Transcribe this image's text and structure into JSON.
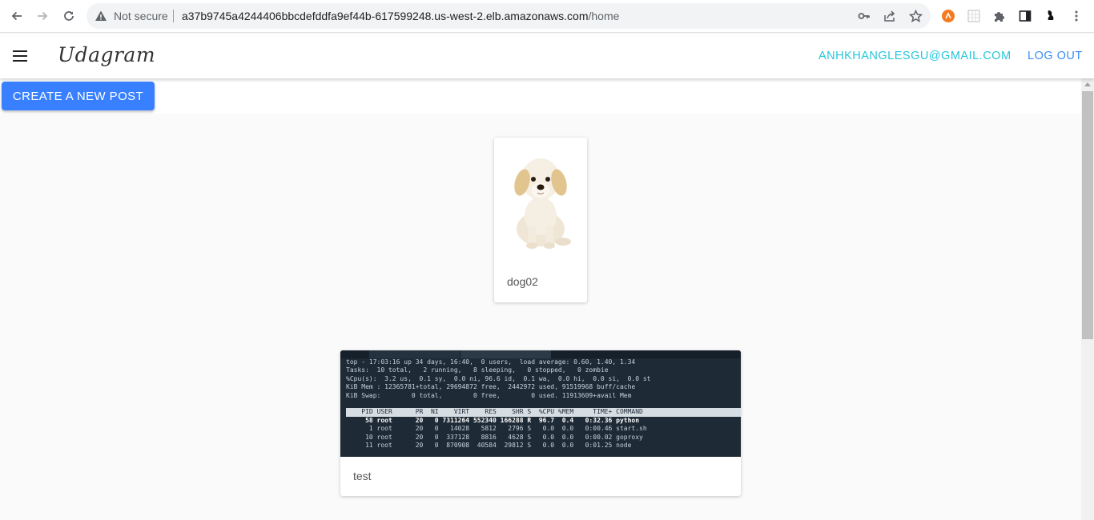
{
  "browser": {
    "security_label": "Not secure",
    "url_host": "a37b9745a4244406bbcdefddfa9ef44b-617599248.us-west-2.elb.amazonaws.com",
    "url_path": "/home"
  },
  "appbar": {
    "brand": "Udagram",
    "user_email": "ANHKHANGLESGU@GMAIL.COM",
    "logout_label": "LOG OUT"
  },
  "actions": {
    "create_post_label": "CREATE A NEW POST"
  },
  "feed": {
    "items": [
      {
        "caption": "dog02"
      },
      {
        "caption": "test"
      }
    ]
  },
  "terminal": {
    "lines": [
      "top - 17:03:16 up 34 days, 16:40,  0 users,  load average: 0.60, 1.40, 1.34",
      "Tasks:  10 total,   2 running,   8 sleeping,   0 stopped,   0 zombie",
      "%Cpu(s):  3.2 us,  0.1 sy,  0.0 ni, 96.6 id,  0.1 wa,  0.0 hi,  0.0 si,  0.0 st",
      "KiB Mem : 12365781+total, 29694872 free,  2442972 used, 91519968 buff/cache",
      "KiB Swap:        0 total,        0 free,        0 used. 11913609+avail Mem"
    ],
    "header": "    PID USER      PR  NI    VIRT    RES    SHR S  %CPU %MEM     TIME+ COMMAND",
    "rows": [
      "     58 root      20   0 7311264 552340 166288 R  96.7  0.4   0:32.36 python",
      "      1 root      20   0   14028   5812   2796 S   0.0  0.0   0:00.46 start.sh",
      "     10 root      20   0  337128   8816   4628 S   0.0  0.0   0:00.02 goproxy",
      "     11 root      20   0  870908  40584  29812 S   0.0  0.0   0:01.25 node"
    ]
  },
  "colors": {
    "primary": "#3880ff",
    "email": "#26c6da",
    "logout": "#3a8ef7",
    "background": "#fafafa"
  }
}
